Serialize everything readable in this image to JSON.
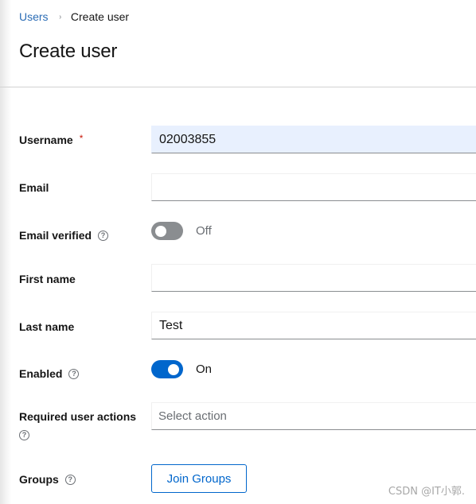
{
  "breadcrumb": {
    "parent": "Users",
    "separator": "›",
    "current": "Create user"
  },
  "page_title": "Create user",
  "form": {
    "username": {
      "label": "Username",
      "required_mark": "*",
      "value": "02003855"
    },
    "email": {
      "label": "Email",
      "value": ""
    },
    "email_verified": {
      "label": "Email verified",
      "help_icon": "help-icon",
      "state": "Off"
    },
    "first_name": {
      "label": "First name",
      "value": ""
    },
    "last_name": {
      "label": "Last name",
      "value": "Test"
    },
    "enabled": {
      "label": "Enabled",
      "help_icon": "help-icon",
      "state": "On"
    },
    "required_actions": {
      "label": "Required user actions",
      "help_icon": "help-icon",
      "placeholder": "Select action"
    },
    "groups": {
      "label": "Groups",
      "help_icon": "help-icon",
      "button_label": "Join Groups"
    }
  },
  "help_glyph": "?",
  "watermark": "CSDN @IT小郭.",
  "colors": {
    "accent": "#0066cc",
    "required": "#c9190b",
    "toggle_off": "#8a8d90",
    "autofill_bg": "#e8f0fe"
  }
}
